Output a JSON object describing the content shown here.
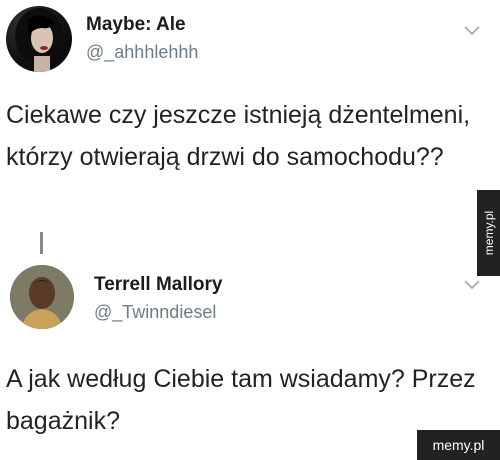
{
  "tweets": [
    {
      "display_name": "Maybe: Ale",
      "handle": "@_ahhhlehhh",
      "text": "Ciekawe czy jeszcze istnieją dżentelmeni, którzy otwierają drzwi do samochodu??",
      "avatar_icon": "profile-photo-dark-hair",
      "menu_icon": "chevron-down-icon"
    },
    {
      "display_name": "Terrell Mallory",
      "handle": "@_Twinndiesel",
      "text": "A jak według Ciebie tam wsiadamy? Przez bagażnik?",
      "avatar_icon": "profile-photo-man",
      "menu_icon": "chevron-down-icon"
    }
  ],
  "watermarks": {
    "side": "memy.pl",
    "corner": "memy.pl"
  }
}
